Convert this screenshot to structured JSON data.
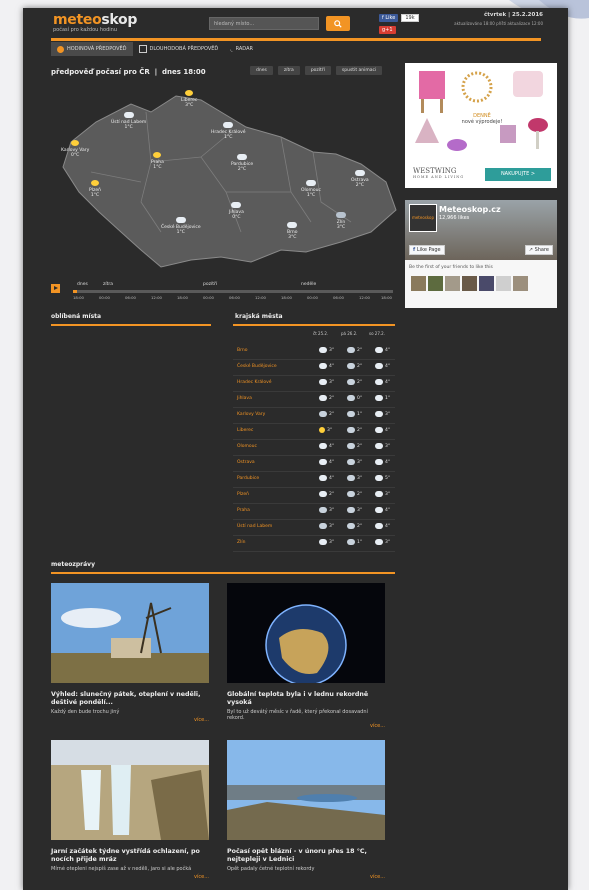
{
  "header": {
    "logo_a": "meteo",
    "logo_b": "skop",
    "slogan": "počasí pro každou hodinu",
    "search_placeholder": "hledaný místo...",
    "fb_like": "Like",
    "fb_count": "19k",
    "gplus": "g+1",
    "date": "čtvrtek | 25.2.2016",
    "updated": "aktualizováno 18:00 příští aktualizace 12:00"
  },
  "nav": [
    {
      "label": "HODINOVÁ PŘEDPOVĚĎ",
      "icon": "sun-icon"
    },
    {
      "label": "DLOUHODOBÁ PŘEDPOVĚĎ",
      "icon": "calendar-icon"
    },
    {
      "label": "RADAR",
      "icon": "rss-icon"
    }
  ],
  "map": {
    "title": "předpověď počasí pro ČR",
    "time": "dnes 18:00",
    "tabs": [
      "dnes",
      "zítra",
      "pozítří",
      "spustit animaci"
    ],
    "cities": [
      {
        "name": "Liberec",
        "temp": "3°C",
        "icon": "sun"
      },
      {
        "name": "Ústí nad Labem",
        "temp": "1°C",
        "icon": "cloud"
      },
      {
        "name": "Hradec Králové",
        "temp": "1°C",
        "icon": "cloud"
      },
      {
        "name": "Karlovy Vary",
        "temp": "0°C",
        "icon": "sun"
      },
      {
        "name": "Praha",
        "temp": "1°C",
        "icon": "sun"
      },
      {
        "name": "Pardubice",
        "temp": "2°C",
        "icon": "cloud"
      },
      {
        "name": "Plzeň",
        "temp": "1°C",
        "icon": "sun"
      },
      {
        "name": "Olomouc",
        "temp": "1°C",
        "icon": "cloud"
      },
      {
        "name": "Ostrava",
        "temp": "2°C",
        "icon": "cloud"
      },
      {
        "name": "Jihlava",
        "temp": "0°C",
        "icon": "cloud"
      },
      {
        "name": "České Budějovice",
        "temp": "1°C",
        "icon": "cloud"
      },
      {
        "name": "Brno",
        "temp": "3°C",
        "icon": "cloud"
      },
      {
        "name": "Zlín",
        "temp": "3°C",
        "icon": "rain"
      }
    ],
    "timeline": {
      "days": [
        "dnes",
        "zítra",
        "pozítří",
        "neděle"
      ],
      "hours": [
        "18:00",
        "00:00",
        "06:00",
        "12:00",
        "18:00",
        "00:00",
        "06:00",
        "12:00",
        "18:00",
        "00:00",
        "06:00",
        "12:00",
        "18:00"
      ]
    }
  },
  "ad": {
    "text1": "DENNĚ",
    "text2": "nové výprodeje!",
    "brand": "WESTWING",
    "brand_sub": "HOME AND LIVING",
    "cta": "NAKUPUJTE >"
  },
  "fb_widget": {
    "name": "Meteoskop.cz",
    "likes": "12,966 likes",
    "like_page": "Like Page",
    "share": "Share",
    "friends": "Be the first of your friends to like this"
  },
  "sections": {
    "favorites": "oblíbená místa",
    "regional": "krajská města",
    "news": "meteozprávy"
  },
  "regional": {
    "days": [
      "čt 25.2.",
      "pá 26.2.",
      "so 27.2."
    ],
    "rows": [
      {
        "city": "Brno",
        "t": [
          "3°",
          "2°",
          "4°"
        ],
        "i": [
          "c",
          "r",
          "c"
        ]
      },
      {
        "city": "České Budějovice",
        "t": [
          "4°",
          "2°",
          "4°"
        ],
        "i": [
          "c",
          "r",
          "c"
        ]
      },
      {
        "city": "Hradec Králové",
        "t": [
          "3°",
          "2°",
          "4°"
        ],
        "i": [
          "c",
          "r",
          "c"
        ]
      },
      {
        "city": "Jihlava",
        "t": [
          "2°",
          "0°",
          "1°"
        ],
        "i": [
          "c",
          "r",
          "c"
        ]
      },
      {
        "city": "Karlovy Vary",
        "t": [
          "2°",
          "1°",
          "3°"
        ],
        "i": [
          "r",
          "r",
          "c"
        ]
      },
      {
        "city": "Liberec",
        "t": [
          "3°",
          "2°",
          "4°"
        ],
        "i": [
          "s",
          "r",
          "c"
        ]
      },
      {
        "city": "Olomouc",
        "t": [
          "4°",
          "2°",
          "3°"
        ],
        "i": [
          "c",
          "r",
          "c"
        ]
      },
      {
        "city": "Ostrava",
        "t": [
          "4°",
          "3°",
          "4°"
        ],
        "i": [
          "c",
          "r",
          "c"
        ]
      },
      {
        "city": "Pardubice",
        "t": [
          "4°",
          "3°",
          "5°"
        ],
        "i": [
          "c",
          "r",
          "c"
        ]
      },
      {
        "city": "Plzeň",
        "t": [
          "2°",
          "2°",
          "3°"
        ],
        "i": [
          "c",
          "r",
          "c"
        ]
      },
      {
        "city": "Praha",
        "t": [
          "3°",
          "3°",
          "4°"
        ],
        "i": [
          "r",
          "r",
          "c"
        ]
      },
      {
        "city": "Ústí nad Labem",
        "t": [
          "3°",
          "2°",
          "4°"
        ],
        "i": [
          "r",
          "r",
          "c"
        ]
      },
      {
        "city": "Zlín",
        "t": [
          "3°",
          "1°",
          "3°"
        ],
        "i": [
          "c",
          "r",
          "c"
        ]
      }
    ]
  },
  "news": [
    {
      "title": "Výhled: slunečný pátek, oteplení v neděli, deštivé pondělí...",
      "text": "Každý den bude trochu jiný",
      "more": "více..."
    },
    {
      "title": "Globální teplota byla i v lednu rekordně vysoká",
      "text": "Byl to už devátý měsíc v řadě, který překonal dosavadní rekord.",
      "more": "více..."
    },
    {
      "title": "Jarní začátek týdne vystřídá ochlazení, po nocích přijde mráz",
      "text": "Mírné otepleni nejspíš zase až v neděli, jaro si ale počká",
      "more": "více..."
    },
    {
      "title": "Počasí opět blázní - v únoru přes 18 °C, nejtepleji v Lednici",
      "text": "Opět padaly četné teplotní rekordy",
      "more": "více..."
    }
  ]
}
